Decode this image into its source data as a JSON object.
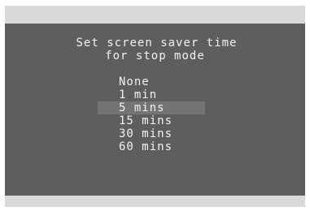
{
  "prompt": {
    "line1": "Set screen saver time",
    "line2": "for stop mode"
  },
  "options": [
    {
      "label": "None",
      "selected": false
    },
    {
      "label": "1 min",
      "selected": false
    },
    {
      "label": "5 mins",
      "selected": true
    },
    {
      "label": "15 mins",
      "selected": false
    },
    {
      "label": "30 mins",
      "selected": false
    },
    {
      "label": "60 mins",
      "selected": false
    }
  ]
}
